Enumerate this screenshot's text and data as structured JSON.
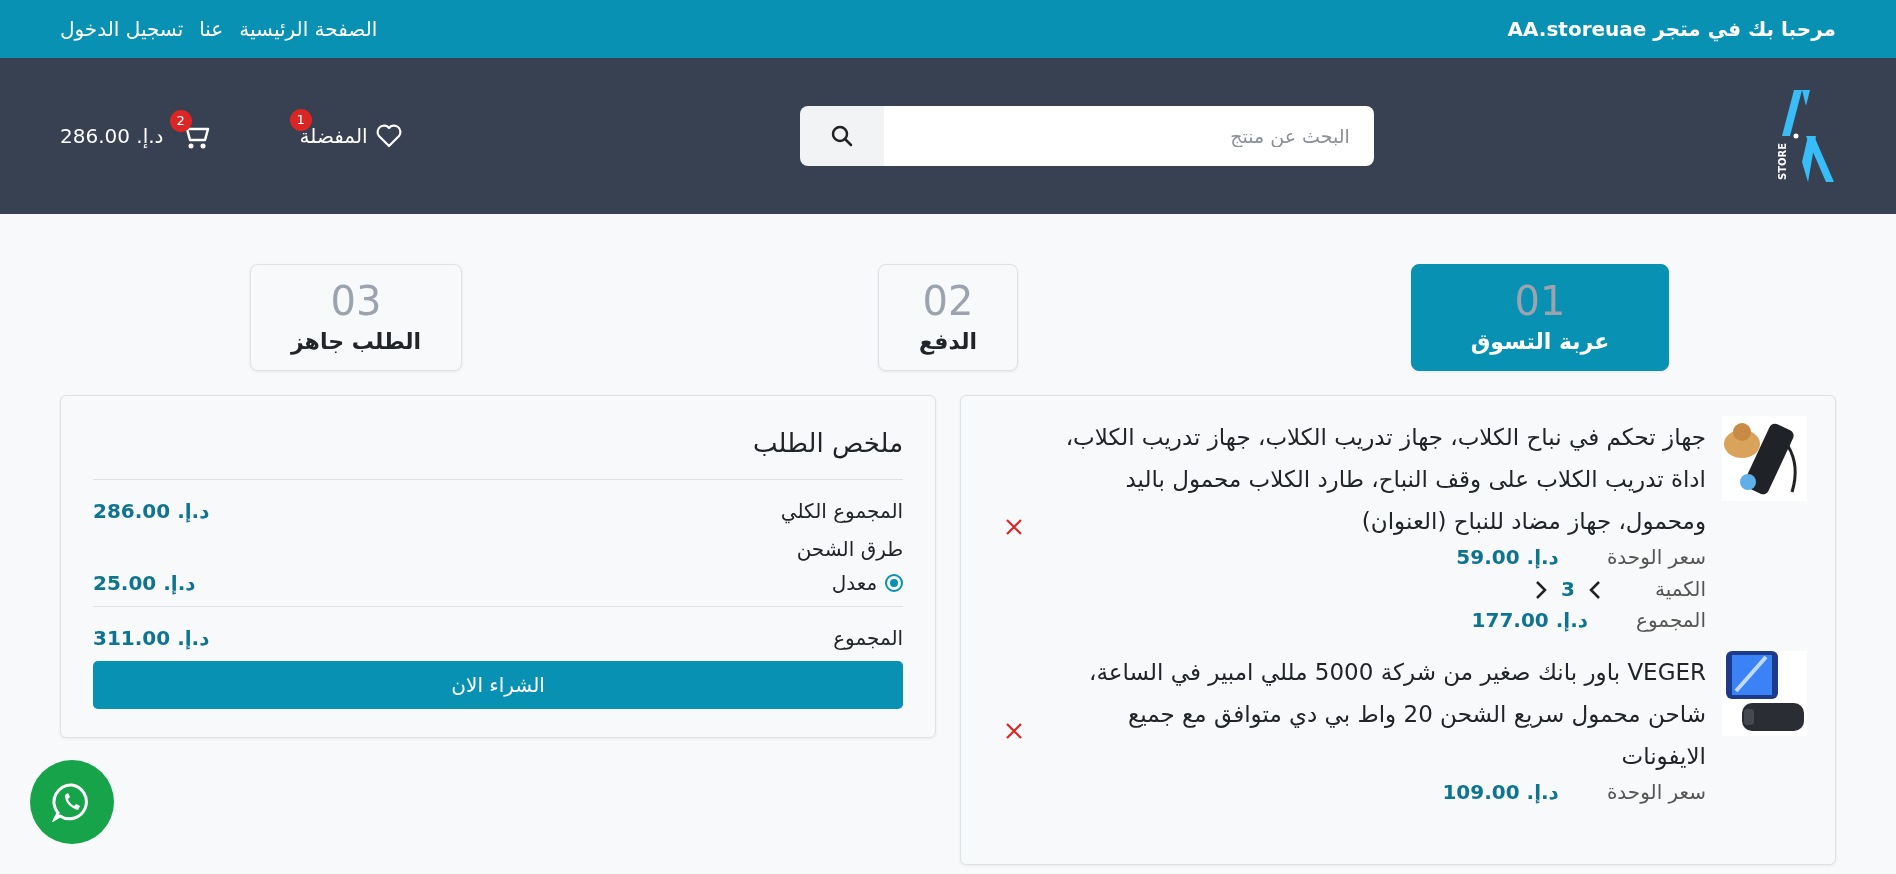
{
  "top_bar": {
    "welcome": "مرحبا بك في متجر AA.storeuae",
    "links": [
      "الصفحة الرئيسية",
      "عنا",
      "تسجيل الدخول"
    ]
  },
  "header": {
    "logo_text": "STORE",
    "search": {
      "placeholder": "البحث عن منتج"
    },
    "favorites": {
      "label": "المفضلة",
      "badge": "1"
    },
    "cart": {
      "badge": "2",
      "total": "د.إ. 286.00"
    }
  },
  "steps": [
    {
      "number": "01",
      "label": "عربة التسوق",
      "selected": true
    },
    {
      "number": "02",
      "label": "الدفع",
      "selected": false
    },
    {
      "number": "03",
      "label": "الطلب جاهز",
      "selected": false
    }
  ],
  "cart_items": [
    {
      "title": "جهاز تحكم في نباح الكلاب، جهاز تدريب الكلاب، جهاز تدريب الكلاب، اداة تدريب الكلاب على وقف النباح، طارد الكلاب محمول باليد ومحمول، جهاز مضاد للنباح (العنوان)",
      "unit_price_label": "سعر الوحدة",
      "unit_price": "د.إ. 59.00",
      "quantity_label": "الكمية",
      "quantity": "3",
      "total_label": "المجموع",
      "total": "د.إ. 177.00",
      "kind": "picture"
    },
    {
      "title": "VEGER باور بانك صغير من شركة 5000 مللي امبير في الساعة، شاحن محمول سريع الشحن 20 واط بي دي متوافق مع جميع الايفونات",
      "unit_price_label": "سعر الوحدة",
      "unit_price": "د.إ. 109.00",
      "kind": "picture"
    }
  ],
  "summary": {
    "title": "ملخص الطلب",
    "subtotal_label": "المجموع الكلي",
    "subtotal": "د.إ. 286.00",
    "shipping_label": "طرق الشحن",
    "shipping_options": [
      {
        "label": "معدل",
        "price": "د.إ. 25.00",
        "selected": true
      }
    ],
    "total_label": "المجموع",
    "total": "د.إ. 311.00",
    "buy_button": "الشراء الان"
  }
}
